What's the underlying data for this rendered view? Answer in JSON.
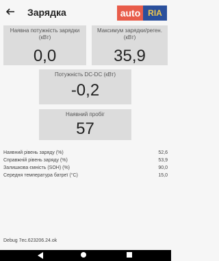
{
  "header": {
    "title": "Зарядка",
    "logo_left": "auto",
    "logo_right": "RIA"
  },
  "cards": {
    "available_charge_power": {
      "label": "Наявна потужність зарядки (кВт)",
      "value": "0,0"
    },
    "max_charge_regen": {
      "label": "Максимум зарядки/реген. (кВт)",
      "value": "35,9"
    },
    "dcdc_power": {
      "label": "Потужність DC-DC (кВт)",
      "value": "-0,2"
    },
    "available_range": {
      "label": "Наявний пробіг",
      "value": "57"
    }
  },
  "stats": [
    {
      "label": "Наявний рівень заряду (%)",
      "value": "52,6"
    },
    {
      "label": "Справжній рівень заряду (%)",
      "value": "53,9"
    },
    {
      "label": "Залишкова ємність (SOH) (%)",
      "value": "90,0"
    },
    {
      "label": "Середня температура батреї (°C)",
      "value": "15,0"
    }
  ],
  "footer": {
    "debug": "Debug 7ec.623206.24.ok"
  },
  "icons": {
    "back": "arrow-left-icon",
    "nav_back": "triangle-back-icon",
    "nav_home": "circle-home-icon",
    "nav_recent": "square-recent-icon"
  }
}
